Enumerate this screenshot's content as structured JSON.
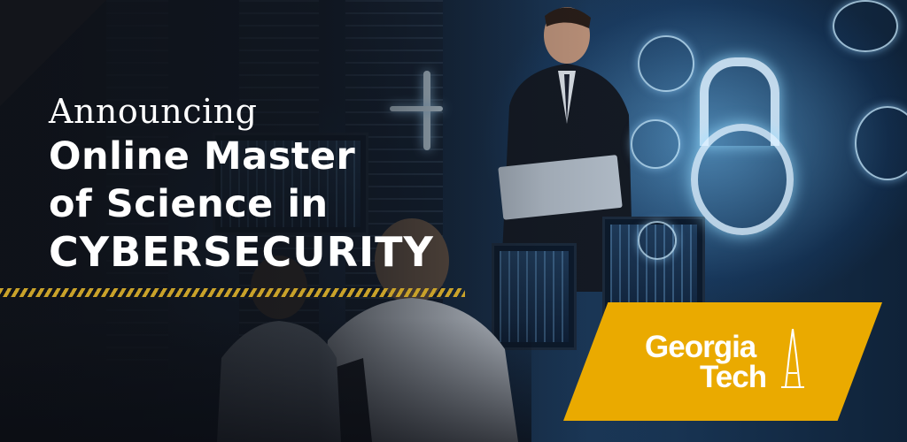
{
  "headline": {
    "eyebrow": "Announcing",
    "line1": "Online Master",
    "line2": "of Science in",
    "line3": "CYBERSECURITY"
  },
  "logo": {
    "line1": "Georgia",
    "line2": "Tech"
  },
  "colors": {
    "brand_gold": "#eaaa00",
    "stripe_gold": "#c9a22a",
    "text": "#ffffff"
  },
  "icons": [
    "lock-icon",
    "wifi-icon",
    "tower-icon"
  ]
}
